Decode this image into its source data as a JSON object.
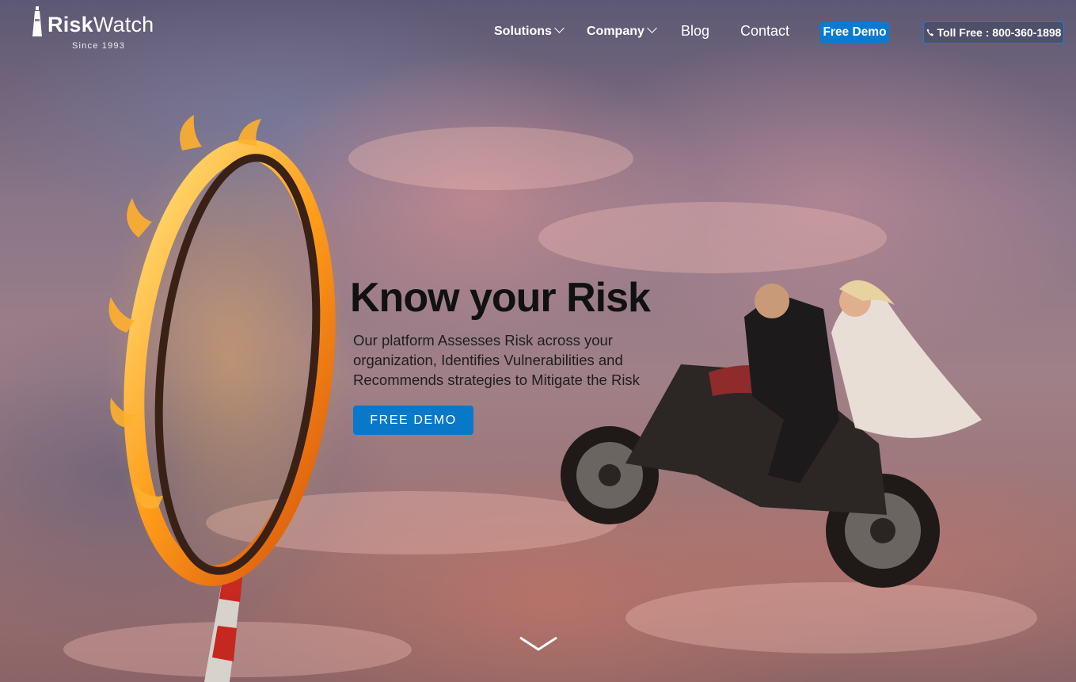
{
  "brand": {
    "name_bold": "Risk",
    "name_light": "Watch",
    "tagline": "Since 1993"
  },
  "nav": {
    "items": [
      {
        "label": "Solutions",
        "has_dropdown": true
      },
      {
        "label": "Company",
        "has_dropdown": true
      },
      {
        "label": "Blog",
        "has_dropdown": false
      },
      {
        "label": "Contact",
        "has_dropdown": false
      }
    ],
    "demo_label": "Free Demo",
    "phone_label": "Toll Free : 800-360-1898"
  },
  "hero": {
    "title": "Know your Risk",
    "subtitle": "Our platform Assesses Risk across your organization, Identifies Vulnerabilities and Recommends strategies to Mitigate the Risk",
    "cta_label": "FREE DEMO"
  },
  "icons": {
    "logo": "lighthouse-icon",
    "dropdown": "chevron-down-icon",
    "phone": "phone-icon",
    "scroll": "chevron-down-icon"
  },
  "colors": {
    "accent": "#0a7bd0",
    "headline": "#111111",
    "nav_text": "#ffffff"
  }
}
